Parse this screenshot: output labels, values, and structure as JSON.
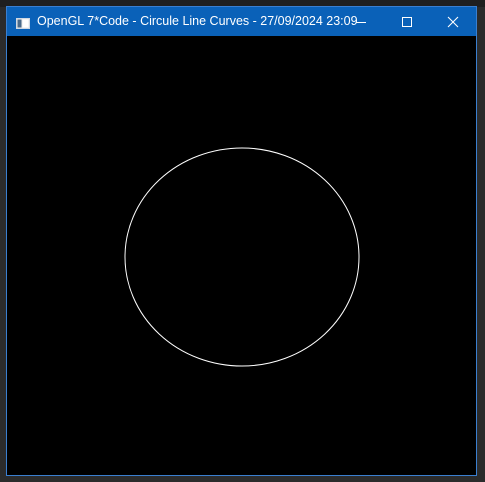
{
  "window": {
    "title": "OpenGL 7*Code - Circule Line Curves - 27/09/2024 23:09",
    "titlebar_color": "#0a61b8",
    "border_color": "#3a7fd0",
    "icons": {
      "app": "app-window-icon",
      "minimize": "minimize-icon",
      "maximize": "maximize-icon",
      "close": "close-icon"
    }
  },
  "canvas": {
    "background_color": "#000000",
    "shape": "circle-outline",
    "stroke_color": "#ffffff"
  }
}
